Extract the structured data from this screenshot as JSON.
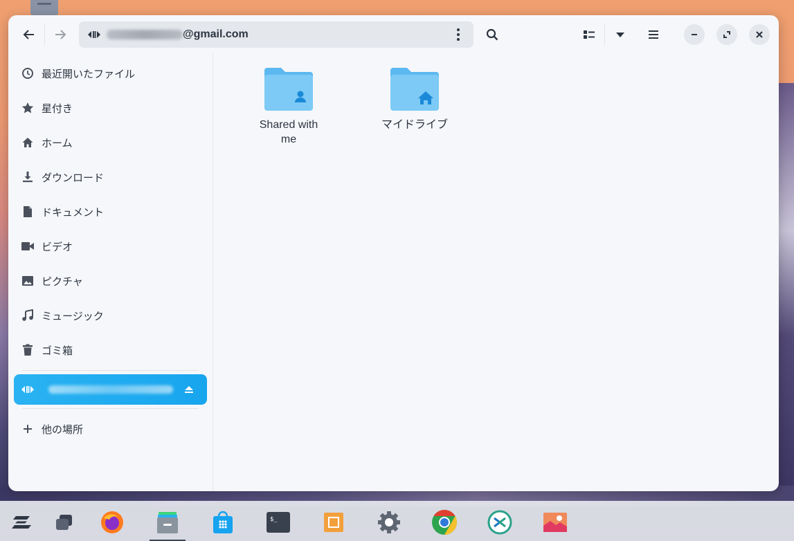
{
  "window": {
    "path": {
      "email_suffix": "@gmail.com"
    }
  },
  "sidebar": {
    "items": [
      {
        "label": "最近開いたファイル",
        "icon": "clock-icon"
      },
      {
        "label": "星付き",
        "icon": "star-icon"
      },
      {
        "label": "ホーム",
        "icon": "home-icon"
      },
      {
        "label": "ダウンロード",
        "icon": "download-icon"
      },
      {
        "label": "ドキュメント",
        "icon": "document-icon"
      },
      {
        "label": "ビデオ",
        "icon": "video-icon"
      },
      {
        "label": "ピクチャ",
        "icon": "picture-icon"
      },
      {
        "label": "ミュージック",
        "icon": "music-icon"
      },
      {
        "label": "ゴミ箱",
        "icon": "trash-icon"
      }
    ],
    "other_locations": "他の場所"
  },
  "content": {
    "files": [
      {
        "label": "Shared with me",
        "icon": "shared-folder-icon"
      },
      {
        "label": "マイドライブ",
        "icon": "drive-folder-icon"
      }
    ]
  },
  "taskbar": {
    "apps": [
      "zorin-menu-icon",
      "workspaces-icon",
      "firefox-icon",
      "files-icon",
      "software-icon",
      "terminal-icon",
      "virtualbox-icon",
      "settings-icon",
      "chrome-icon",
      "zorin-connect-icon",
      "image-viewer-icon"
    ]
  },
  "colors": {
    "accent": "#17a5ee",
    "folder": "#7ccaf5",
    "text": "#2c3440"
  }
}
